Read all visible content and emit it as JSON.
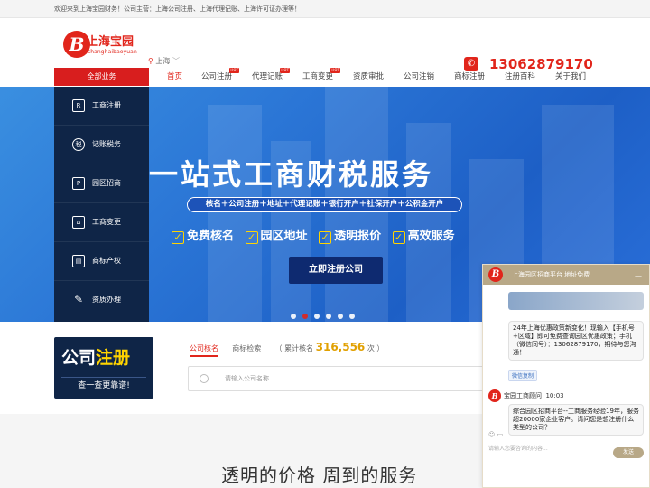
{
  "topbar": {
    "text": "欢迎来到上海宝园财务！公司主营：上海公司注册、上海代理记账、上海许可证办理等！"
  },
  "header": {
    "logo_title": "上海宝园",
    "logo_sub": "shanghaibaoyuan",
    "logo_mark": "B",
    "city": "上海",
    "phone": "13062879170"
  },
  "nav": {
    "all_label": "全部业务",
    "items": [
      {
        "label": "首页"
      },
      {
        "label": "公司注册",
        "hot": "HOT"
      },
      {
        "label": "代理记账",
        "hot": "HOT"
      },
      {
        "label": "工商变更",
        "hot": "HOT"
      },
      {
        "label": "资质审批"
      },
      {
        "label": "公司注销"
      },
      {
        "label": "商标注册"
      },
      {
        "label": "注册百科"
      },
      {
        "label": "关于我们"
      }
    ]
  },
  "sidebar": {
    "items": [
      {
        "label": "工商注册",
        "icon": "R"
      },
      {
        "label": "记账税务",
        "icon": "税"
      },
      {
        "label": "园区招商",
        "icon": "P"
      },
      {
        "label": "工商变更",
        "icon": "⌂"
      },
      {
        "label": "商标产权",
        "icon": "▤"
      },
      {
        "label": "资质办理",
        "icon": "✎"
      }
    ]
  },
  "hero": {
    "title": "一站式工商财税服务",
    "pill": "核名＋公司注册＋地址＋代理记账＋银行开户＋社保开户＋公积金开户",
    "features": [
      "免费核名",
      "园区地址",
      "透明报价",
      "高效服务"
    ],
    "cta": "立即注册公司",
    "slides": 6,
    "active_slide": 2
  },
  "register": {
    "title_a": "公司",
    "title_b": "注册",
    "subtitle": "查一查更靠谱!",
    "tab_active": "公司核名",
    "tab_other": "商标检索",
    "count_prefix": "（ 累计核名",
    "count_value": "316,556",
    "count_suffix": "次 ）",
    "search_placeholder": "请输入公司名称"
  },
  "slogan": "透明的价格  周到的服务",
  "chat": {
    "title": "上海园区招商平台 地址免费",
    "msg1": "24年上海优惠政策新变化！现输入【手机号+区域】即可免费查询园区优惠政策；手机（微信同号）：13062879170，期待与您沟通！",
    "copy_btn": "微信复制",
    "agent_name": "宝园工商顾问",
    "agent_time": "10:03",
    "msg2": "综合园区招商平台--工商服务经验19年，服务超20000家企业客户。请问您是想注册什么类型的公司？",
    "tools": "☺  ▭",
    "input_placeholder": "请输入您要咨询的内容...",
    "send": "发送"
  },
  "colors": {
    "brand": "#e1251b",
    "navy": "#0f2547",
    "gold": "#b8a887",
    "accent": "#ffd400"
  }
}
